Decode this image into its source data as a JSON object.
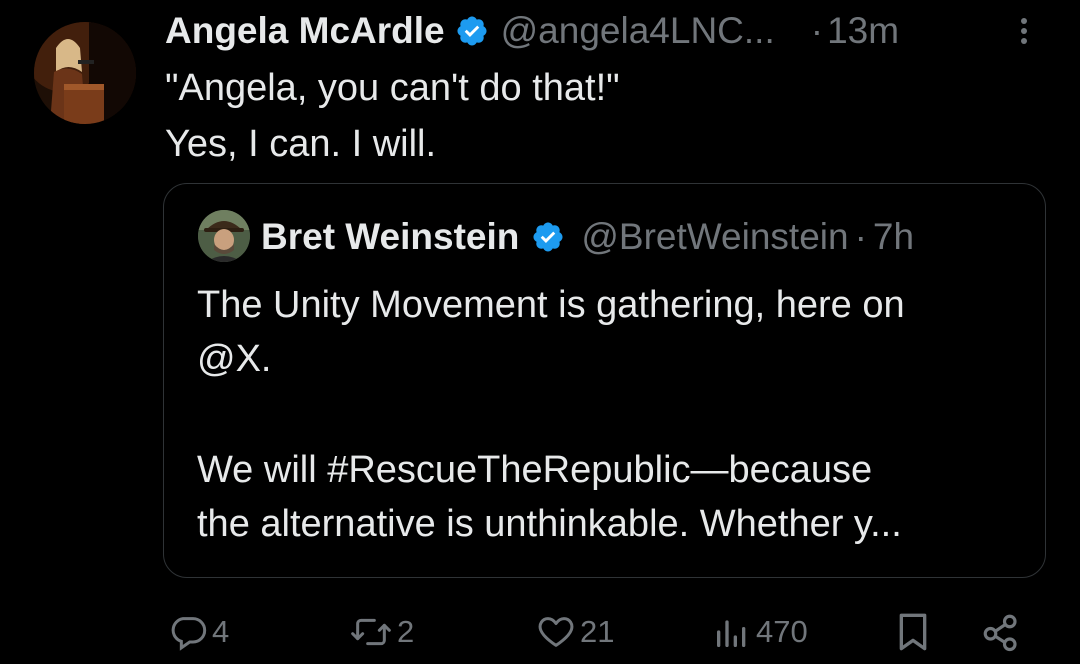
{
  "tweet": {
    "author_name": "Angela McArdle",
    "handle": "@angela4LNC...",
    "separator": "·",
    "time": "13m",
    "text_lines": [
      "\"Angela, you can't do that!\"",
      "Yes, I can. I will."
    ]
  },
  "quoted_tweet": {
    "author_name": "Bret Weinstein",
    "handle": "@BretWeinstein",
    "separator": "·",
    "time": "7h",
    "text_lines": [
      "The Unity Movement is gathering, here on",
      "@X.",
      "We will #RescueTheRepublic—because",
      "the alternative is unthinkable. Whether y..."
    ]
  },
  "actions": {
    "replies": "4",
    "reposts": "2",
    "likes": "21",
    "views": "470"
  },
  "colors": {
    "background": "#000000",
    "text": "#e7e9ea",
    "muted": "#71767b",
    "verified": "#1d9bf0",
    "border": "#2f3336"
  },
  "icons": [
    "more-icon",
    "verified-badge-icon",
    "reply-icon",
    "repost-icon",
    "like-icon",
    "views-icon",
    "bookmark-icon",
    "share-icon"
  ]
}
